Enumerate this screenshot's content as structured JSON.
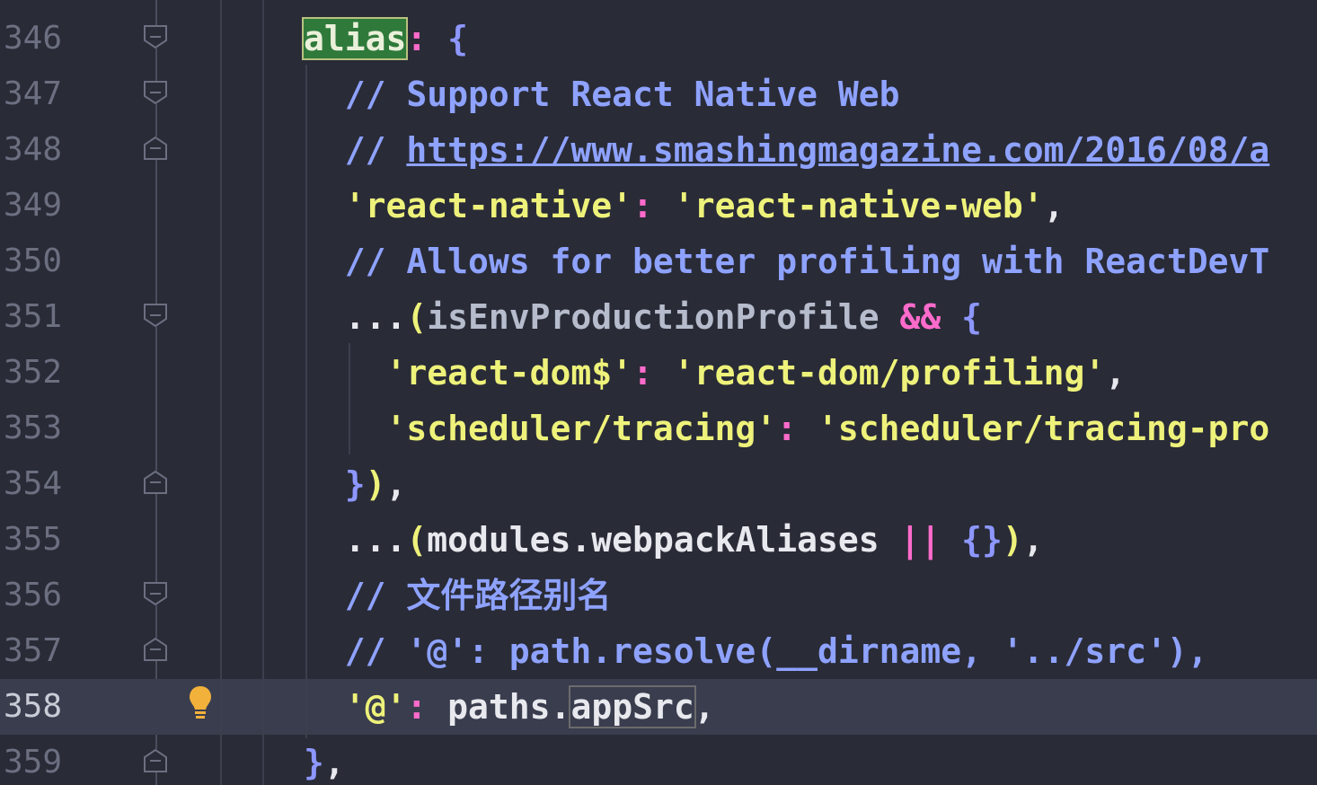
{
  "editor": {
    "lines": [
      {
        "num": "346",
        "tokens": [
          {
            "t": "alias",
            "c": "hl-alias"
          },
          {
            "t": ": ",
            "c": "t-colon"
          },
          {
            "t": "{",
            "c": "t-brace"
          }
        ]
      },
      {
        "num": "347",
        "tokens": [
          {
            "t": "  // Support React Native Web",
            "c": "t-com"
          }
        ]
      },
      {
        "num": "348",
        "tokens": [
          {
            "t": "  // ",
            "c": "t-com"
          },
          {
            "t": "https://www.smashingmagazine.com/2016/08/a",
            "c": "t-link"
          }
        ]
      },
      {
        "num": "349",
        "tokens": [
          {
            "t": "  'react-native'",
            "c": "t-str"
          },
          {
            "t": ": ",
            "c": "t-colon"
          },
          {
            "t": "'react-native-web'",
            "c": "t-str"
          },
          {
            "t": ",",
            "c": "t-id"
          }
        ]
      },
      {
        "num": "350",
        "tokens": [
          {
            "t": "  // Allows for better profiling with ReactDevT",
            "c": "t-com"
          }
        ]
      },
      {
        "num": "351",
        "tokens": [
          {
            "t": "  ...",
            "c": "t-id"
          },
          {
            "t": "(",
            "c": "t-paren"
          },
          {
            "t": "isEnvProductionProfile ",
            "c": "t-var"
          },
          {
            "t": "&&",
            "c": "t-op"
          },
          {
            "t": " {",
            "c": "t-brace"
          }
        ]
      },
      {
        "num": "352",
        "tokens": [
          {
            "t": "    'react-dom$'",
            "c": "t-str"
          },
          {
            "t": ": ",
            "c": "t-colon"
          },
          {
            "t": "'react-dom/profiling'",
            "c": "t-str"
          },
          {
            "t": ",",
            "c": "t-id"
          }
        ]
      },
      {
        "num": "353",
        "tokens": [
          {
            "t": "    'scheduler/tracing'",
            "c": "t-str"
          },
          {
            "t": ": ",
            "c": "t-colon"
          },
          {
            "t": "'scheduler/tracing-pro",
            "c": "t-str"
          }
        ]
      },
      {
        "num": "354",
        "tokens": [
          {
            "t": "  }",
            "c": "t-brace"
          },
          {
            "t": ")",
            "c": "t-paren"
          },
          {
            "t": ",",
            "c": "t-id"
          }
        ]
      },
      {
        "num": "355",
        "tokens": [
          {
            "t": "  ...",
            "c": "t-id"
          },
          {
            "t": "(",
            "c": "t-paren"
          },
          {
            "t": "modules.webpackAliases ",
            "c": "t-id"
          },
          {
            "t": "||",
            "c": "t-op"
          },
          {
            "t": " {}",
            "c": "t-brace"
          },
          {
            "t": ")",
            "c": "t-paren"
          },
          {
            "t": ",",
            "c": "t-id"
          }
        ]
      },
      {
        "num": "356",
        "tokens": [
          {
            "t": "  // 文件路径别名",
            "c": "t-com"
          }
        ]
      },
      {
        "num": "357",
        "tokens": [
          {
            "t": "  // '@': path.resolve(__dirname, '../src'),",
            "c": "t-com"
          }
        ]
      },
      {
        "num": "358",
        "current": true,
        "tokens": [
          {
            "t": "  '@'",
            "c": "t-str"
          },
          {
            "t": ": ",
            "c": "t-colon"
          },
          {
            "t": "paths.",
            "c": "t-id"
          },
          {
            "t": "appSrc",
            "c": "hl-box t-id"
          },
          {
            "t": ",",
            "c": "t-id"
          }
        ]
      },
      {
        "num": "359",
        "tokens": [
          {
            "t": "}",
            "c": "t-brace"
          },
          {
            "t": ",",
            "c": "t-id"
          }
        ]
      }
    ],
    "fold_markers": [
      {
        "line": "346",
        "kind": "open"
      },
      {
        "line": "347",
        "kind": "open"
      },
      {
        "line": "348",
        "kind": "close"
      },
      {
        "line": "351",
        "kind": "open"
      },
      {
        "line": "354",
        "kind": "close"
      },
      {
        "line": "356",
        "kind": "open"
      },
      {
        "line": "357",
        "kind": "close"
      },
      {
        "line": "359",
        "kind": "close"
      }
    ],
    "gutter_icons": [
      {
        "line": "358",
        "icon": "lightbulb-icon"
      }
    ]
  }
}
